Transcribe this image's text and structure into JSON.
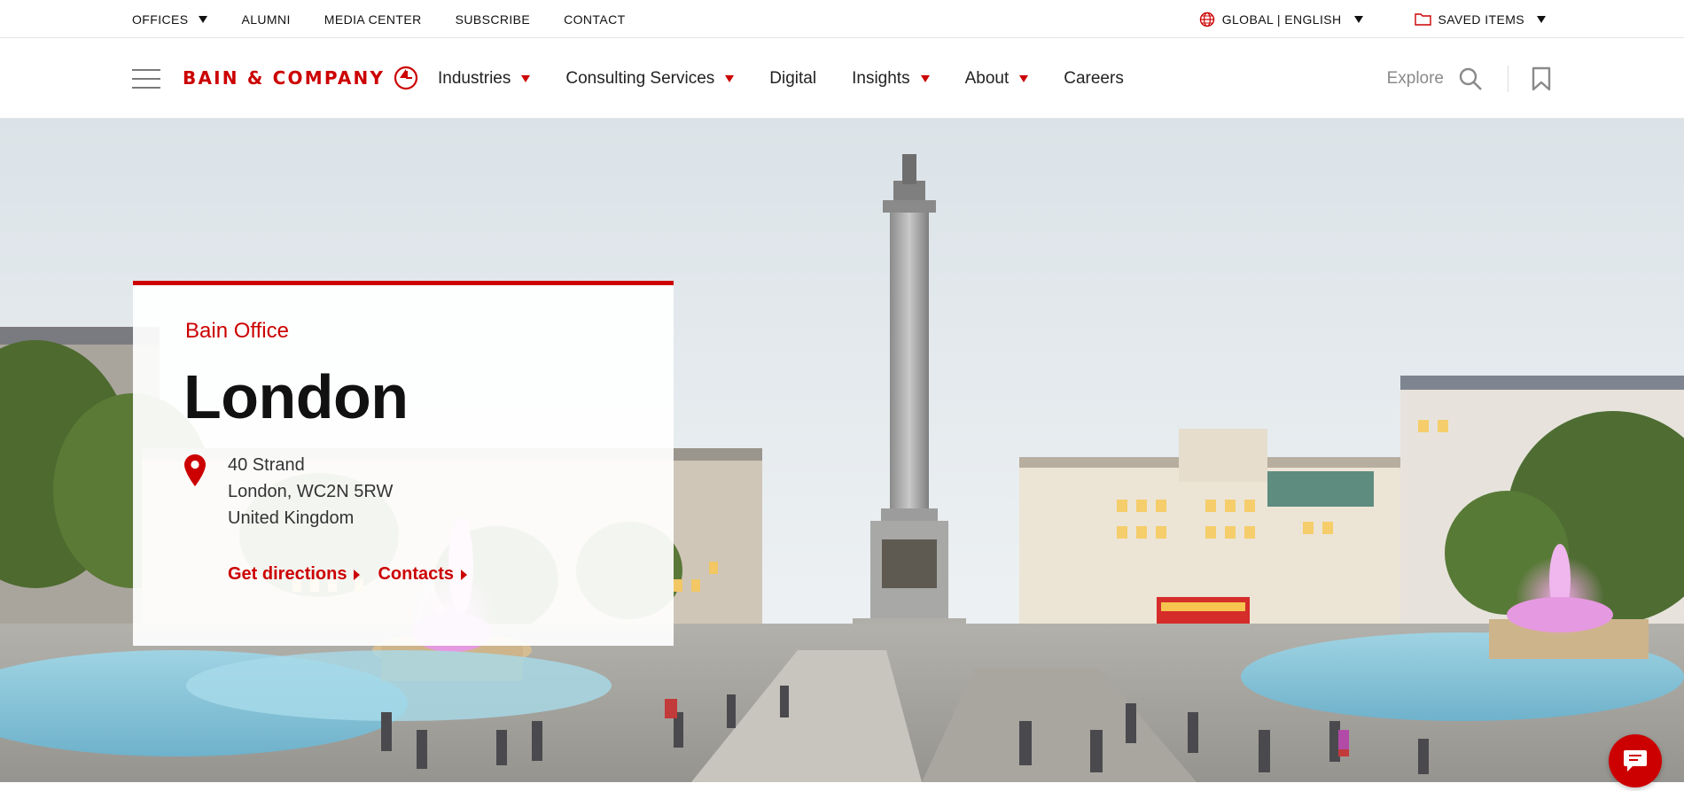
{
  "utility": {
    "offices": "OFFICES",
    "alumni": "ALUMNI",
    "media_center": "MEDIA CENTER",
    "subscribe": "SUBSCRIBE",
    "contact": "CONTACT",
    "language": "GLOBAL | ENGLISH",
    "saved_items": "SAVED ITEMS"
  },
  "nav": {
    "logo_text": "BAIN & COMPANY",
    "items": [
      {
        "label": "Industries"
      },
      {
        "label": "Consulting Services"
      },
      {
        "label": "Digital"
      },
      {
        "label": "Insights"
      },
      {
        "label": "About"
      },
      {
        "label": "Careers"
      }
    ],
    "explore": "Explore"
  },
  "office": {
    "label": "Bain Office",
    "title": "London",
    "address_line1": "40 Strand",
    "address_line2": "London, WC2N 5RW",
    "address_line3": "United Kingdom",
    "get_directions": "Get directions",
    "contacts": "Contacts"
  },
  "colors": {
    "brand_red": "#cc0000",
    "text_dark": "#111111",
    "muted_gray": "#8a8a8a"
  },
  "icons": {
    "menu": "hamburger-menu-icon",
    "logo_mark": "bain-logo-mark-icon",
    "globe": "globe-icon",
    "folder": "folder-icon",
    "search": "search-icon",
    "bookmark": "bookmark-icon",
    "pin": "location-pin-icon",
    "chat": "chat-icon"
  }
}
